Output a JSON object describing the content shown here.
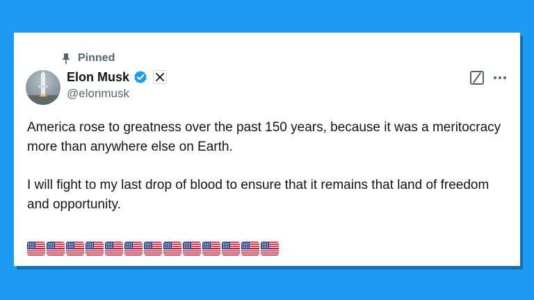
{
  "pinned_label": "Pinned",
  "author": {
    "display_name": "Elon Musk",
    "handle": "@elonmusk",
    "verified": true,
    "affiliation_badge": "x-logo-icon"
  },
  "tweet": {
    "paragraphs": [
      "America rose to greatness over the past 150 years, because it was a meritocracy more than anywhere else on Earth.",
      "I will fight to my last drop of blood to ensure that it remains that land of freedom and opportunity."
    ],
    "flag_emoji_count": 13
  },
  "icons": {
    "pin": "pin-icon",
    "verified": "verified-badge-icon",
    "grok": "grok-icon",
    "more": "more-options-icon"
  },
  "colors": {
    "background": "#1d9bf0",
    "card": "#ffffff",
    "text": "#0f1419",
    "secondary": "#536471",
    "verified": "#1d9bf0"
  }
}
